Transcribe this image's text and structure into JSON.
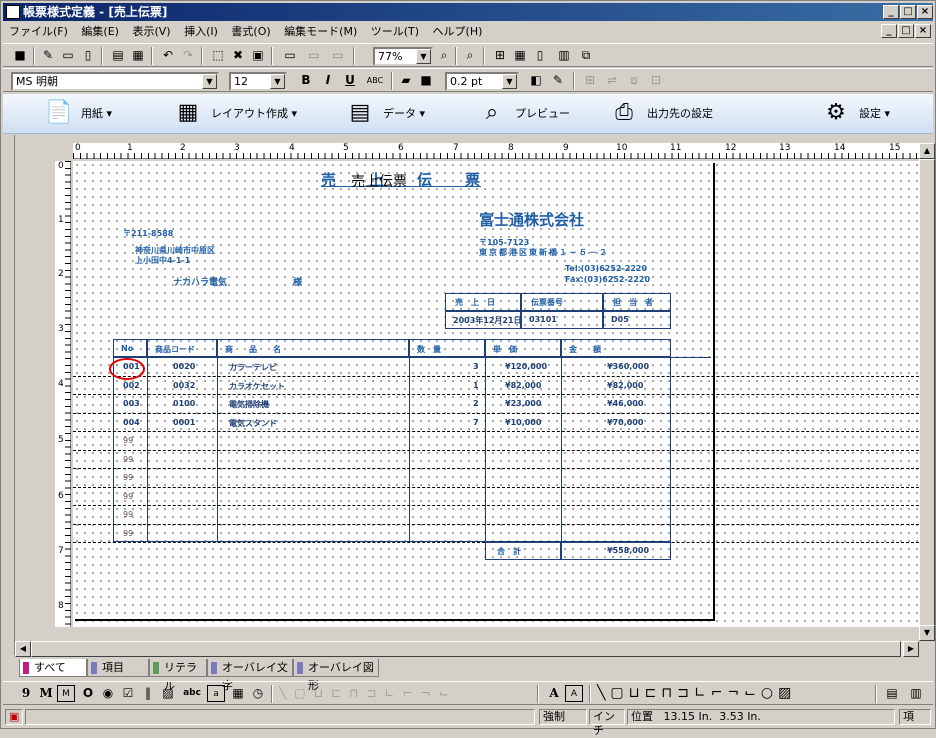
{
  "window": {
    "title": "帳票様式定義 - [売上伝票]"
  },
  "window_controls": {
    "min": "_",
    "max": "□",
    "close": "×"
  },
  "mdi_controls": {
    "min": "_",
    "restore": "□",
    "close": "×"
  },
  "menu": [
    "ファイル(F)",
    "編集(E)",
    "表示(V)",
    "挿入(I)",
    "書式(O)",
    "編集モード(M)",
    "ツール(T)",
    "ヘルプ(H)"
  ],
  "toolbar": {
    "zoom": "77%"
  },
  "formatbar": {
    "font": "MS 明朝",
    "size": "12",
    "bold": "B",
    "italic": "I",
    "underline": "U",
    "abc": "ABC",
    "line_width": "0.2 pt"
  },
  "bigbar": [
    {
      "label": "用紙",
      "icon": "paper-icon"
    },
    {
      "label": "レイアウト作成",
      "icon": "layout-icon"
    },
    {
      "label": "データ",
      "icon": "data-icon"
    },
    {
      "label": "プレビュー",
      "icon": "preview-icon"
    },
    {
      "label": "出力先の設定",
      "icon": "output-icon"
    },
    {
      "label": "設定",
      "icon": "settings-icon"
    }
  ],
  "ruler_h": [
    "0",
    "1",
    "2",
    "3",
    "4",
    "5",
    "6",
    "7",
    "8",
    "9",
    "10",
    "11",
    "12",
    "13",
    "14",
    "15"
  ],
  "ruler_v": [
    "0",
    "1",
    "2",
    "3",
    "4",
    "5",
    "6",
    "7",
    "8"
  ],
  "form": {
    "title": "売上伝票",
    "title_spaced": "売　　上　　伝　　票",
    "company": "富士通株式会社",
    "company_zip": "〒105-7123",
    "company_addr": "東京都港区東新橋１－５－２",
    "tel": "Tel:(03)6252-2220",
    "fax": "Fax:(03)6252-2220",
    "cust_zip": "〒211-8588",
    "cust_addr1": "神奈川県川崎市中原区",
    "cust_addr2": "上小田中4-1-1",
    "cust_name": "ナカハラ電気",
    "cust_suffix": "様",
    "hdr_labels": [
      "売　上　日",
      "伝票番号",
      "担　当　者"
    ],
    "hdr_values": [
      "2003年12月21日",
      "03101",
      "D05"
    ],
    "col_headers": [
      "No",
      "商品コード",
      "商　　品　　名",
      "数　量",
      "単　価",
      "金　　額"
    ],
    "rows": [
      [
        "001",
        "0020",
        "カラーテレビ",
        "3",
        "¥120,000",
        "¥360,000"
      ],
      [
        "002",
        "0032",
        "カラオケセット",
        "1",
        "¥82,000",
        "¥82,000"
      ],
      [
        "003",
        "0100",
        "電気掃除機",
        "2",
        "¥23,000",
        "¥46,000"
      ],
      [
        "004",
        "0001",
        "電気スタンド",
        "7",
        "¥10,000",
        "¥70,000"
      ]
    ],
    "empty_row_no": "99",
    "total_label": "合　計",
    "total_value": "¥558,000"
  },
  "tabs": [
    "すべて",
    "項目",
    "リテラル",
    "オーバレイ文字",
    "オーバレイ図形"
  ],
  "status": {
    "mode": "強制",
    "unit": "インチ",
    "pos_label": "位置",
    "pos_x": "13.15 In.",
    "pos_y": "3.53 In.",
    "last": "項"
  }
}
